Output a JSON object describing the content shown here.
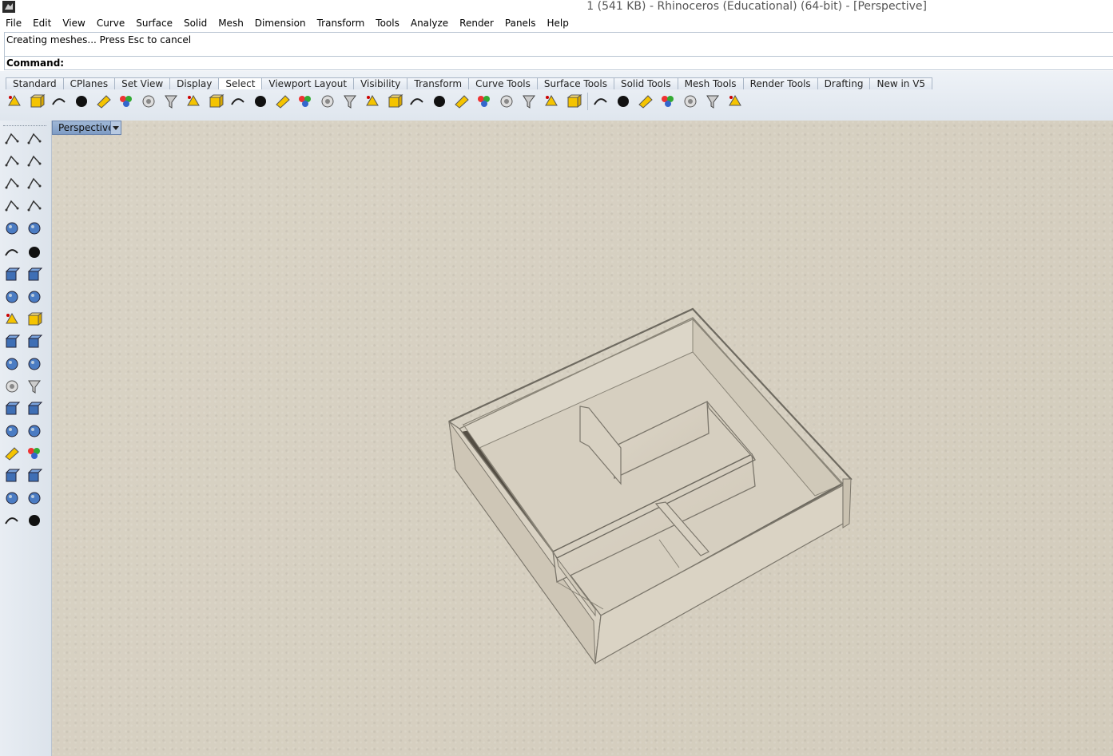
{
  "window": {
    "title": "1 (541 KB) - Rhinoceros (Educational) (64-bit) - [Perspective]"
  },
  "menu": [
    "File",
    "Edit",
    "View",
    "Curve",
    "Surface",
    "Solid",
    "Mesh",
    "Dimension",
    "Transform",
    "Tools",
    "Analyze",
    "Render",
    "Panels",
    "Help"
  ],
  "history": {
    "line": "Creating meshes... Press Esc to cancel"
  },
  "command": {
    "label": "Command:",
    "value": ""
  },
  "toolbar_tabs": [
    "Standard",
    "CPlanes",
    "Set View",
    "Display",
    "Select",
    "Viewport Layout",
    "Visibility",
    "Transform",
    "Curve Tools",
    "Surface Tools",
    "Solid Tools",
    "Mesh Tools",
    "Render Tools",
    "Drafting",
    "New in V5"
  ],
  "active_tab": "Select",
  "toolbar_icons": [
    "select-points-icon",
    "select-control-points-icon",
    "select-all-icon",
    "select-surfaces-icon",
    "select-curves-icon",
    "select-lights-icon",
    "select-text-icon",
    "select-polysurfaces-icon",
    "select-by-color-icon",
    "select-blocks-icon",
    "select-point-cloud-icon",
    "select-points-cloud-icon",
    "select-meshes-icon",
    "select-annotation-icon",
    "select-hatch-icon",
    "select-dimension-icon",
    "select-leader-icon",
    "select-groups-icon",
    "select-sphere-icon",
    "select-extrusion-icon",
    "select-planar-icon",
    "select-grid-icon",
    "select-spiral-icon",
    "select-layer-icon",
    "select-chain-icon",
    "select-render-mesh-icon",
    "select-solid-icon",
    "select-box-icon",
    "select-lightbulb-icon",
    "select-material-icon",
    "select-paint-icon",
    "zoom-select-icon",
    "filter-icon"
  ],
  "left_toolbar_icons": [
    "pointer-icon",
    "point-icon",
    "polyline-icon",
    "curve-control-points-icon",
    "circle-icon",
    "ellipse-icon",
    "arc-icon",
    "rectangle-icon",
    "polygon-icon",
    "fillet-curve-icon",
    "surface-from-points-icon",
    "loft-icon",
    "box-icon",
    "sphere-icon",
    "cylinder-icon",
    "planar-surface-icon",
    "gear-transform-icon",
    "explode-icon",
    "trim-icon",
    "split-icon",
    "boolean-union-icon",
    "group-icon",
    "offset-curve-icon",
    "rebuild-curve-icon",
    "text-icon",
    "dimension-icon",
    "block-icon",
    "mirror-icon",
    "solid-box-icon",
    "array-icon",
    "grid-array-icon",
    "align-icon",
    "analyze-icon",
    "check-icon",
    "render-icon",
    "shade-icon"
  ],
  "viewport": {
    "name": "Perspective"
  },
  "colors": {
    "viewport_bg": "#d7d0c1",
    "accent": "#7e9cc5",
    "icon_yellow": "#f5c400"
  }
}
